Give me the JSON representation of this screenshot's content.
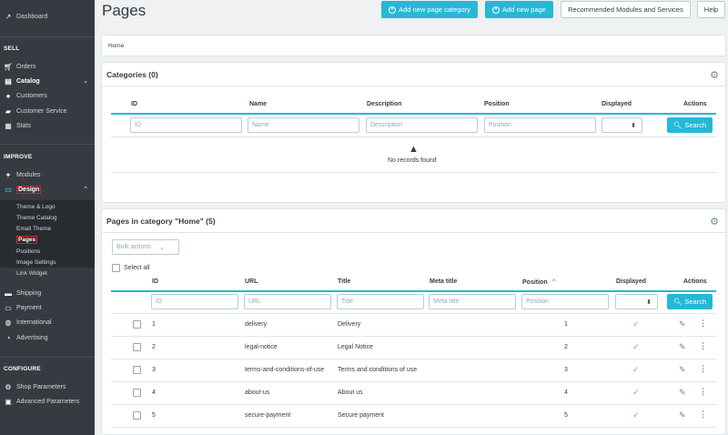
{
  "sidebar": {
    "dashboard": "Dashboard",
    "sell_heading": "SELL",
    "sell_items": [
      "Orders",
      "Catalog",
      "Customers",
      "Customer Service",
      "Stats"
    ],
    "improve_heading": "IMPROVE",
    "improve_items": [
      "Modules",
      "Design"
    ],
    "design_sub": [
      "Theme & Logo",
      "Theme Catalog",
      "Email Theme",
      "Pages",
      "Positions",
      "Image Settings",
      "Link Widget"
    ],
    "improve_items2": [
      "Shipping",
      "Payment",
      "International",
      "Advertising"
    ],
    "configure_heading": "CONFIGURE",
    "configure_items": [
      "Shop Parameters",
      "Advanced Parameters"
    ]
  },
  "header": {
    "title": "Pages",
    "btn_add_category": "Add new page category",
    "btn_add_page": "Add new page",
    "btn_recommended": "Recommended Modules and Services",
    "btn_help": "Help"
  },
  "breadcrumb": "Home",
  "categories": {
    "title": "Categories (0)",
    "headers": [
      "ID",
      "Name",
      "Description",
      "Position",
      "Displayed",
      "Actions"
    ],
    "placeholders": [
      "ID",
      "Name",
      "Description",
      "Position"
    ],
    "search": "Search",
    "empty": "No records found"
  },
  "pages": {
    "title": "Pages in category \"Home\" (5)",
    "bulk": "Bulk actions",
    "select_all": "Select all",
    "headers": [
      "ID",
      "URL",
      "Title",
      "Meta title",
      "Position",
      "Displayed",
      "Actions"
    ],
    "placeholders": [
      "ID",
      "URL",
      "Title",
      "Meta title",
      "Position"
    ],
    "search": "Search",
    "rows": [
      {
        "id": "1",
        "url": "delivery",
        "title": "Delivery",
        "position": "1"
      },
      {
        "id": "2",
        "url": "legal-notice",
        "title": "Legal Notice",
        "position": "2"
      },
      {
        "id": "3",
        "url": "terms-and-conditions-of-use",
        "title": "Terms and conditions of use",
        "position": "3"
      },
      {
        "id": "4",
        "url": "about-us",
        "title": "About us",
        "position": "4"
      },
      {
        "id": "5",
        "url": "secure-payment",
        "title": "Secure payment",
        "position": "5"
      }
    ]
  },
  "colors": {
    "accent": "#25b9d7",
    "sidebar": "#363a41",
    "check": "#70b580",
    "highlight": "#e02020"
  }
}
